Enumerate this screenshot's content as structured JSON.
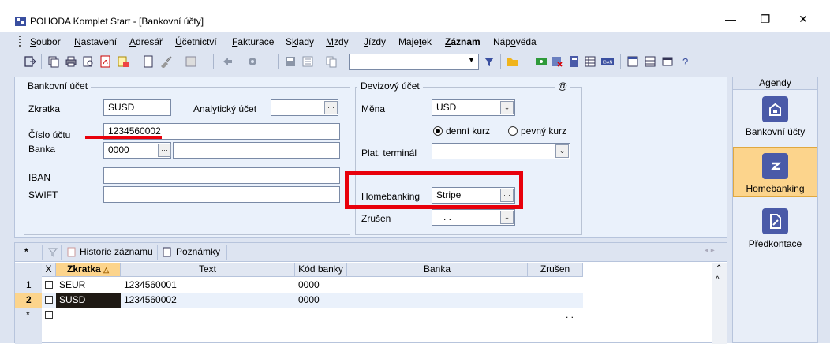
{
  "window": {
    "title": "POHODA Komplet Start - [Bankovní účty]",
    "minimize": "—",
    "restore": "❐",
    "close": "✕"
  },
  "menu": [
    {
      "pre": "",
      "acc": "S",
      "post": "oubor"
    },
    {
      "pre": "",
      "acc": "N",
      "post": "astavení"
    },
    {
      "pre": "",
      "acc": "A",
      "post": "dresář"
    },
    {
      "pre": "",
      "acc": "Ú",
      "post": "četnictví"
    },
    {
      "pre": "",
      "acc": "F",
      "post": "akturace"
    },
    {
      "pre": "S",
      "acc": "k",
      "post": "lady"
    },
    {
      "pre": "",
      "acc": "M",
      "post": "zdy"
    },
    {
      "pre": "",
      "acc": "J",
      "post": "ízdy"
    },
    {
      "pre": "Maje",
      "acc": "t",
      "post": "ek"
    },
    {
      "pre": "",
      "acc": "Z",
      "post": "áznam"
    },
    {
      "pre": "Náp",
      "acc": "o",
      "post": "věda"
    }
  ],
  "form": {
    "bank_group_title": "Bankovní účet",
    "zkratka_label": "Zkratka",
    "zkratka_value": "SUSD",
    "analyticky_label": "Analytický účet",
    "analyticky_value": "",
    "cislo_label": "Číslo účtu",
    "cislo_value": "1234560002",
    "banka_label": "Banka",
    "banka_value": "0000",
    "banka_name": "",
    "iban_label": "IBAN",
    "iban_value": "",
    "swift_label": "SWIFT",
    "swift_value": "",
    "foreign_group_title": "Devizový účet",
    "at_sign": "@",
    "mena_label": "Měna",
    "mena_value": "USD",
    "radio_daily": "denní kurz",
    "radio_fixed": "pevný kurz",
    "terminal_label": "Plat. terminál",
    "terminal_value": "",
    "homebanking_label": "Homebanking",
    "homebanking_value": "Stripe",
    "zrusen_label": "Zrušen",
    "zrusen_value": ". ."
  },
  "sidebar": {
    "header": "Agendy",
    "items": [
      {
        "label": "Bankovní účty"
      },
      {
        "label": "Homebanking"
      },
      {
        "label": "Předkontace"
      }
    ]
  },
  "tabs": {
    "star": "*",
    "history": "Historie záznamu",
    "notes": "Poznámky",
    "arrows": "◂ ▸"
  },
  "grid": {
    "headers": {
      "x": "X",
      "zkratka": "Zkratka",
      "text": "Text",
      "kod": "Kód banky",
      "banka": "Banka",
      "zrusen": "Zrušen"
    },
    "rows": [
      {
        "num": "1",
        "zkratka": "SEUR",
        "text": "1234560001",
        "kod": "0000",
        "banka": "",
        "zrusen": ""
      },
      {
        "num": "2",
        "zkratka": "SUSD",
        "text": "1234560002",
        "kod": "0000",
        "banka": "",
        "zrusen": ""
      },
      {
        "num": "*",
        "zkratka": "",
        "text": "",
        "kod": "",
        "banka": "",
        "zrusen": ". ."
      }
    ]
  }
}
